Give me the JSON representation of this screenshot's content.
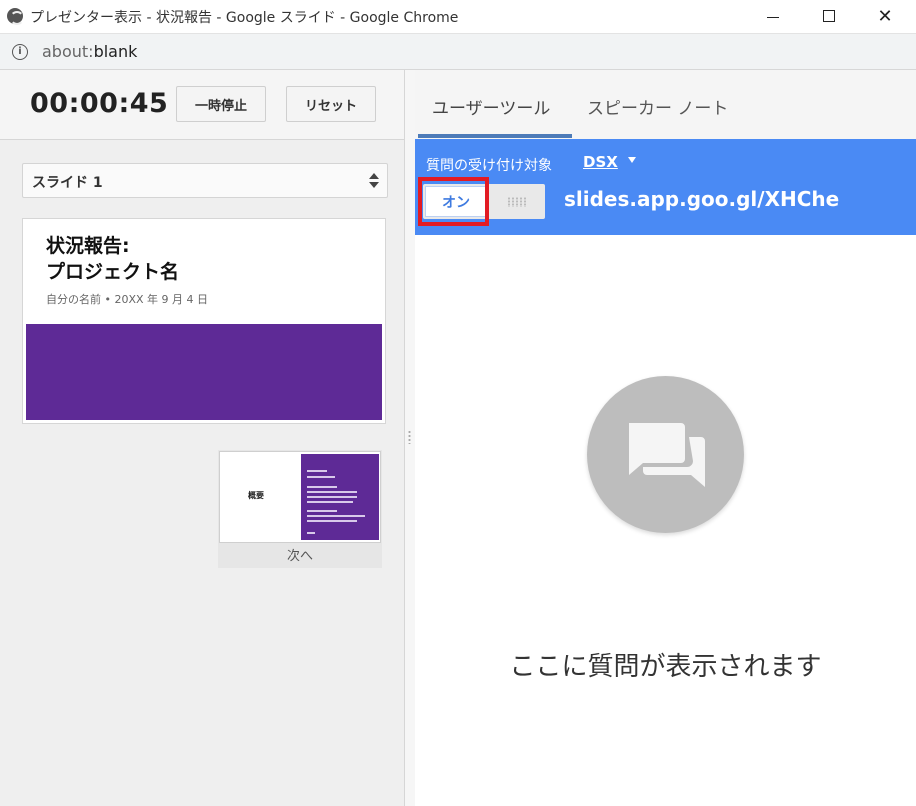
{
  "window": {
    "title": "プレゼンター表示 - 状況報告 - Google スライド - Google Chrome",
    "minimize": "—",
    "maximize": "☐",
    "close": "✕"
  },
  "address": {
    "info": "i",
    "url_scheme": "about:",
    "url_rest": "blank"
  },
  "left": {
    "timer": "00:00:45",
    "pause_label": "一時停止",
    "reset_label": "リセット",
    "slide_select": "スライド 1",
    "current_slide": {
      "title_line1": "状況報告:",
      "title_line2": "プロジェクト名",
      "subtitle": "自分の名前 • 20XX 年 9 月 4 日",
      "band_color": "#5e2a96"
    },
    "next": {
      "thumb_title": "概要",
      "label": "次へ"
    }
  },
  "right": {
    "tabs": [
      "ユーザーツール",
      "スピーカー ノート"
    ],
    "active_tab": 0,
    "qa": {
      "label": "質問の受け付け対象",
      "target": "DSX",
      "toggle_on": "オン",
      "url": "slides.app.goo.gl/XHChe"
    },
    "empty_message": "ここに質問が表示されます",
    "accent_color": "#4a8af4"
  }
}
